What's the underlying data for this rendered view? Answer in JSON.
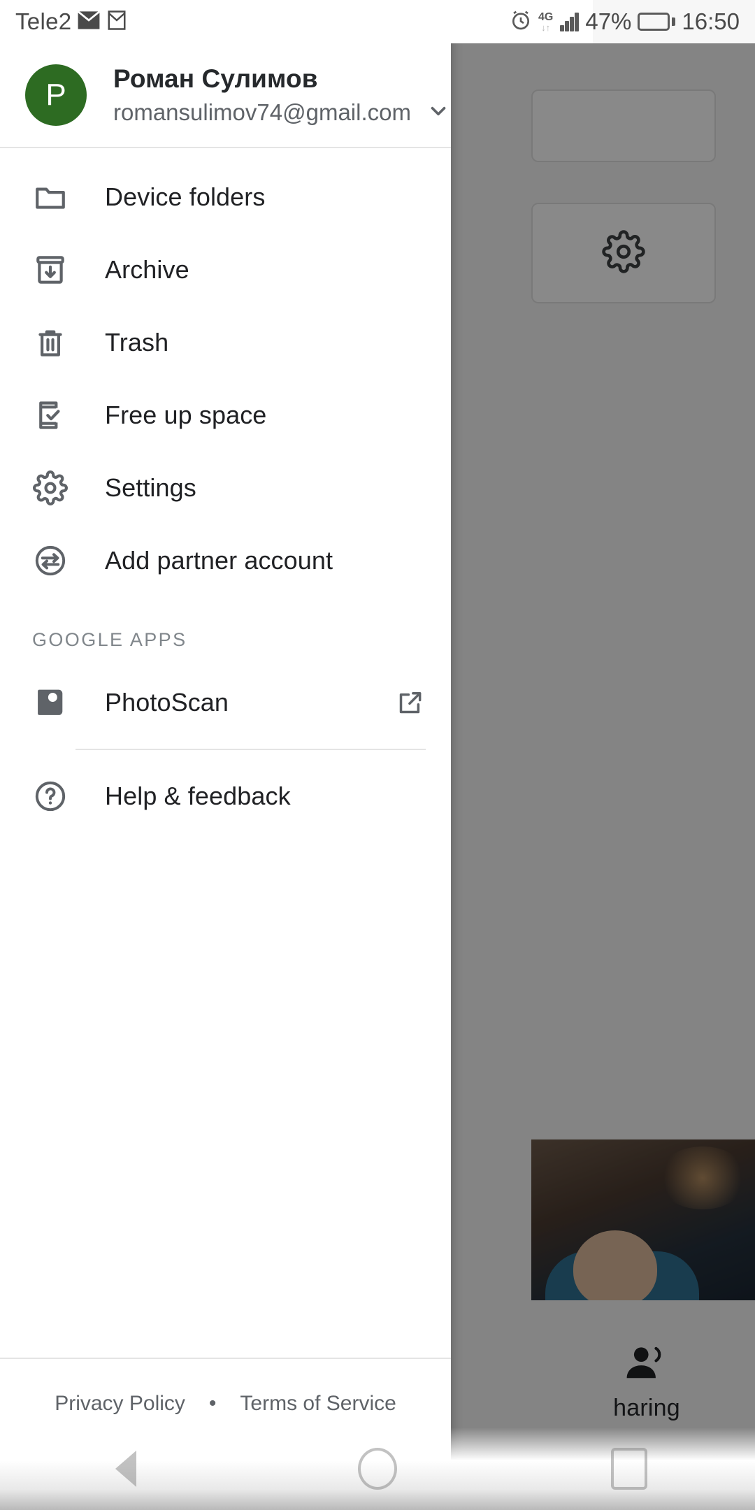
{
  "status_bar": {
    "carrier": "Tele2",
    "mail_icon": "mail-icon",
    "gmail_icon": "gmail-icon",
    "alarm_icon": "alarm-icon",
    "network_type": "4G",
    "network_sub": "↓↑",
    "signal_icon": "signal-bars-icon",
    "battery_percent": "47%",
    "battery_level": 47,
    "battery_icon": "battery-icon",
    "time": "16:50"
  },
  "account": {
    "avatar_initial": "P",
    "avatar_color": "#2d6b22",
    "name": "Роман Сулимов",
    "email": "romansulimov74@gmail.com",
    "expand_icon": "chevron-down-icon"
  },
  "menu": {
    "items": [
      {
        "label": "Device folders",
        "icon": "folder-icon"
      },
      {
        "label": "Archive",
        "icon": "archive-icon"
      },
      {
        "label": "Trash",
        "icon": "trash-icon"
      },
      {
        "label": "Free up space",
        "icon": "phone-check-icon"
      },
      {
        "label": "Settings",
        "icon": "gear-icon"
      },
      {
        "label": "Add partner account",
        "icon": "partner-swap-icon"
      }
    ]
  },
  "google_apps": {
    "section_title": "GOOGLE APPS",
    "items": [
      {
        "label": "PhotoScan",
        "icon": "photoscan-icon",
        "trailing_icon": "external-link-icon"
      }
    ]
  },
  "help": {
    "label": "Help & feedback",
    "icon": "help-circle-icon"
  },
  "footer": {
    "privacy_label": "Privacy Policy",
    "separator": "•",
    "terms_label": "Terms of Service"
  },
  "background": {
    "settings_icon": "gear-icon",
    "sharing_tab_label": "haring",
    "sharing_tab_icon": "people-icon"
  },
  "navbar": {
    "back_icon": "back-triangle-icon",
    "home_icon": "home-circle-icon",
    "recents_icon": "recents-square-icon"
  }
}
